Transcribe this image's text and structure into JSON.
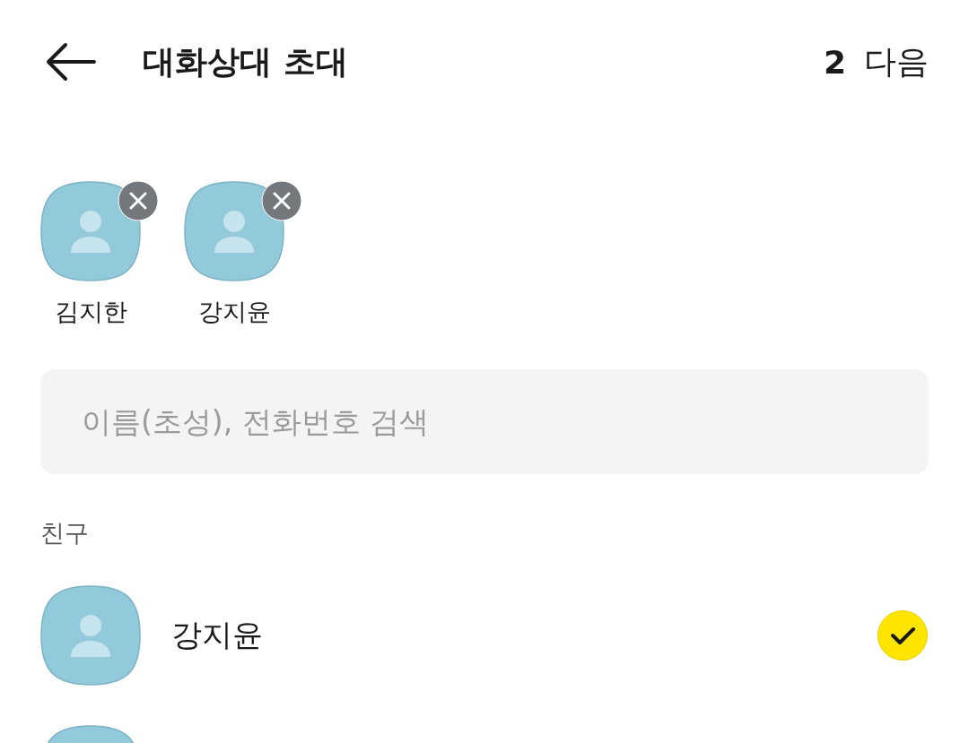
{
  "header": {
    "title": "대화상대 초대",
    "count": "2",
    "next": "다음"
  },
  "selected_contacts": [
    {
      "name": "김지한"
    },
    {
      "name": "강지윤"
    }
  ],
  "search": {
    "placeholder": "이름(초성), 전화번호 검색"
  },
  "section_label": "친구",
  "friends": [
    {
      "kind": "friend",
      "name": "강지윤",
      "selected": true
    },
    {
      "kind": "partial"
    }
  ]
}
